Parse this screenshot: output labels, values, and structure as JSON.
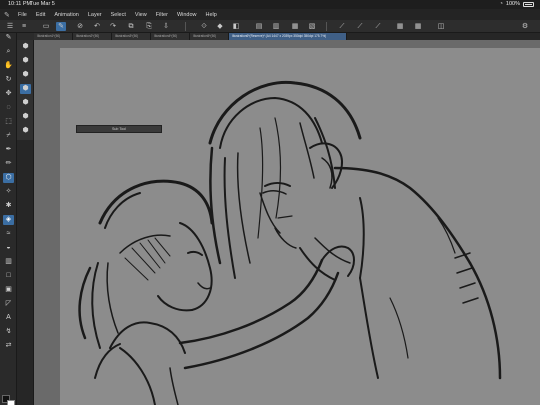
{
  "status_bar": {
    "time": "10:11 PM",
    "date": "Tue Mar 5",
    "battery": "100%"
  },
  "menu": [
    "File",
    "Edit",
    "Animation",
    "Layer",
    "Select",
    "View",
    "Filter",
    "Window",
    "Help"
  ],
  "tabs": [
    {
      "label": "Illustration1*(50)"
    },
    {
      "label": "Illustration2*(50)"
    },
    {
      "label": "Illustration3*(50)"
    },
    {
      "label": "Illustration4*(50)"
    },
    {
      "label": "Illustration5*(50)"
    },
    {
      "label": "Illustration6*(Reserve)* (A4 1447 x 2039px 350dpi 350dpi 175.7%)"
    }
  ],
  "tooltip": {
    "label": "Sub Tool"
  },
  "colors": {
    "accent": "#3b6ea3",
    "canvas": "#8c8c8c",
    "workspace": "#6a6a6a",
    "ink": "#1a1a1a"
  }
}
